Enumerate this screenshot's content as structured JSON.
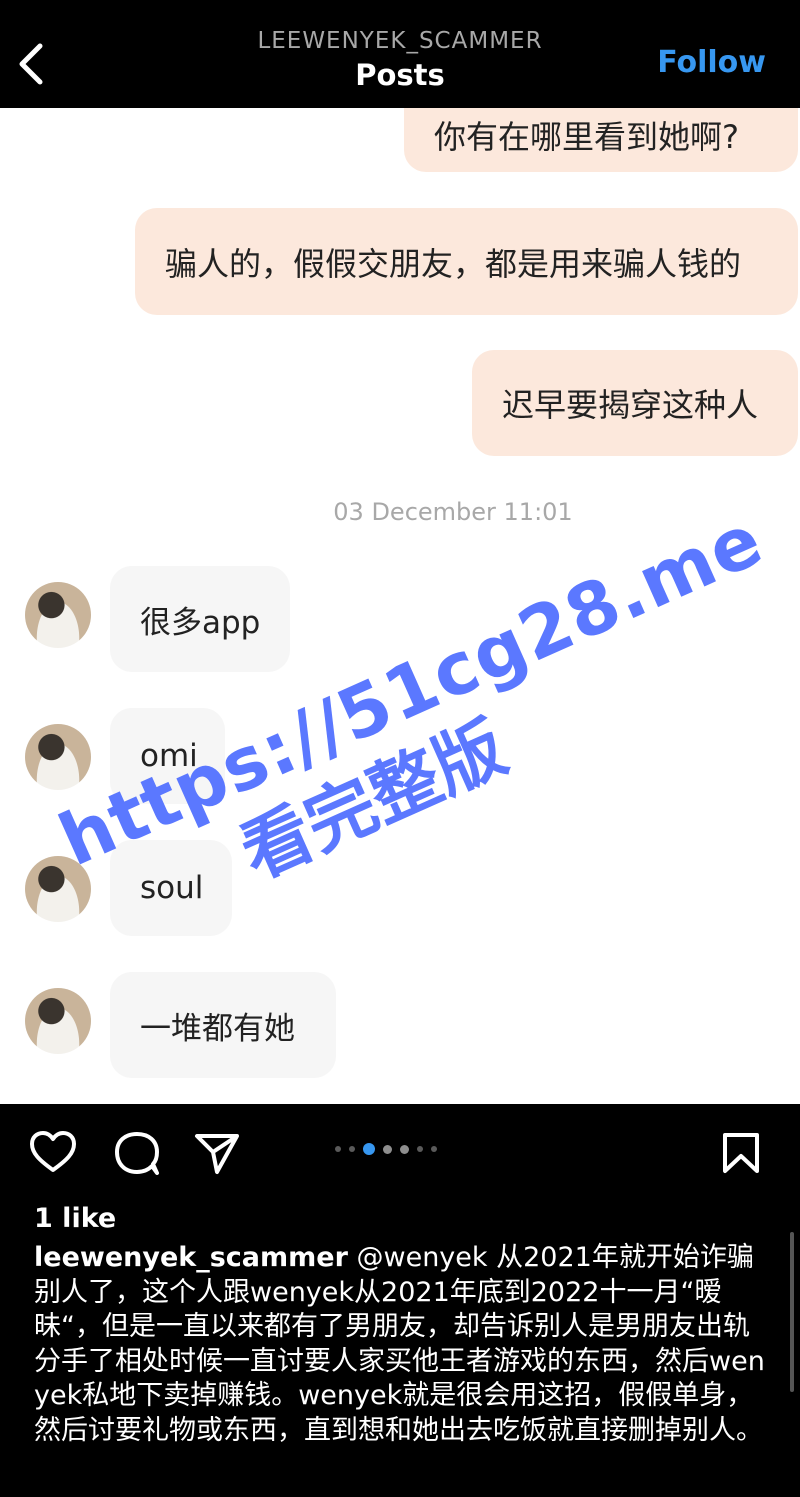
{
  "header": {
    "username": "LEEWENYEK_SCAMMER",
    "title": "Posts",
    "follow_label": "Follow"
  },
  "chat": {
    "outgoing": [
      "你有在哪里看到她啊?",
      "骗人的，假假交朋友，都是用来骗人钱的",
      "迟早要揭穿这种人"
    ],
    "timestamp": "03 December 11:01",
    "incoming": [
      "很多app",
      "omi",
      "soul",
      "一堆都有她"
    ],
    "watermark": {
      "line1": "https://51cg28.me",
      "line2": "看完整版"
    }
  },
  "carousel": {
    "count": 6,
    "active_index": 1
  },
  "post": {
    "likes": "1 like",
    "caption_author": "leewenyek_scammer",
    "caption_text": " @wenyek 从2021年就开始诈骗别人了，这个人跟wenyek从2021年底到2022十一月“暧昧“，但是一直以来都有了男朋友，却告诉别人是男朋友出轨分手了相处时候一直讨要人家买他王者游戏的东西，然后wenyek私地下卖掉赚钱。wenyek就是很会用这招，假假单身，然后讨要礼物或东西，直到想和她出去吃饭就直接删掉别人。"
  },
  "icons": {
    "back": "chevron-left-icon",
    "like": "heart-icon",
    "comment": "comment-icon",
    "share": "send-icon",
    "save": "bookmark-icon"
  },
  "colors": {
    "accent": "#3797f0",
    "outgoing_bubble": "#fce8dc",
    "incoming_bubble": "#f6f6f6",
    "watermark": "#5b78ff"
  }
}
